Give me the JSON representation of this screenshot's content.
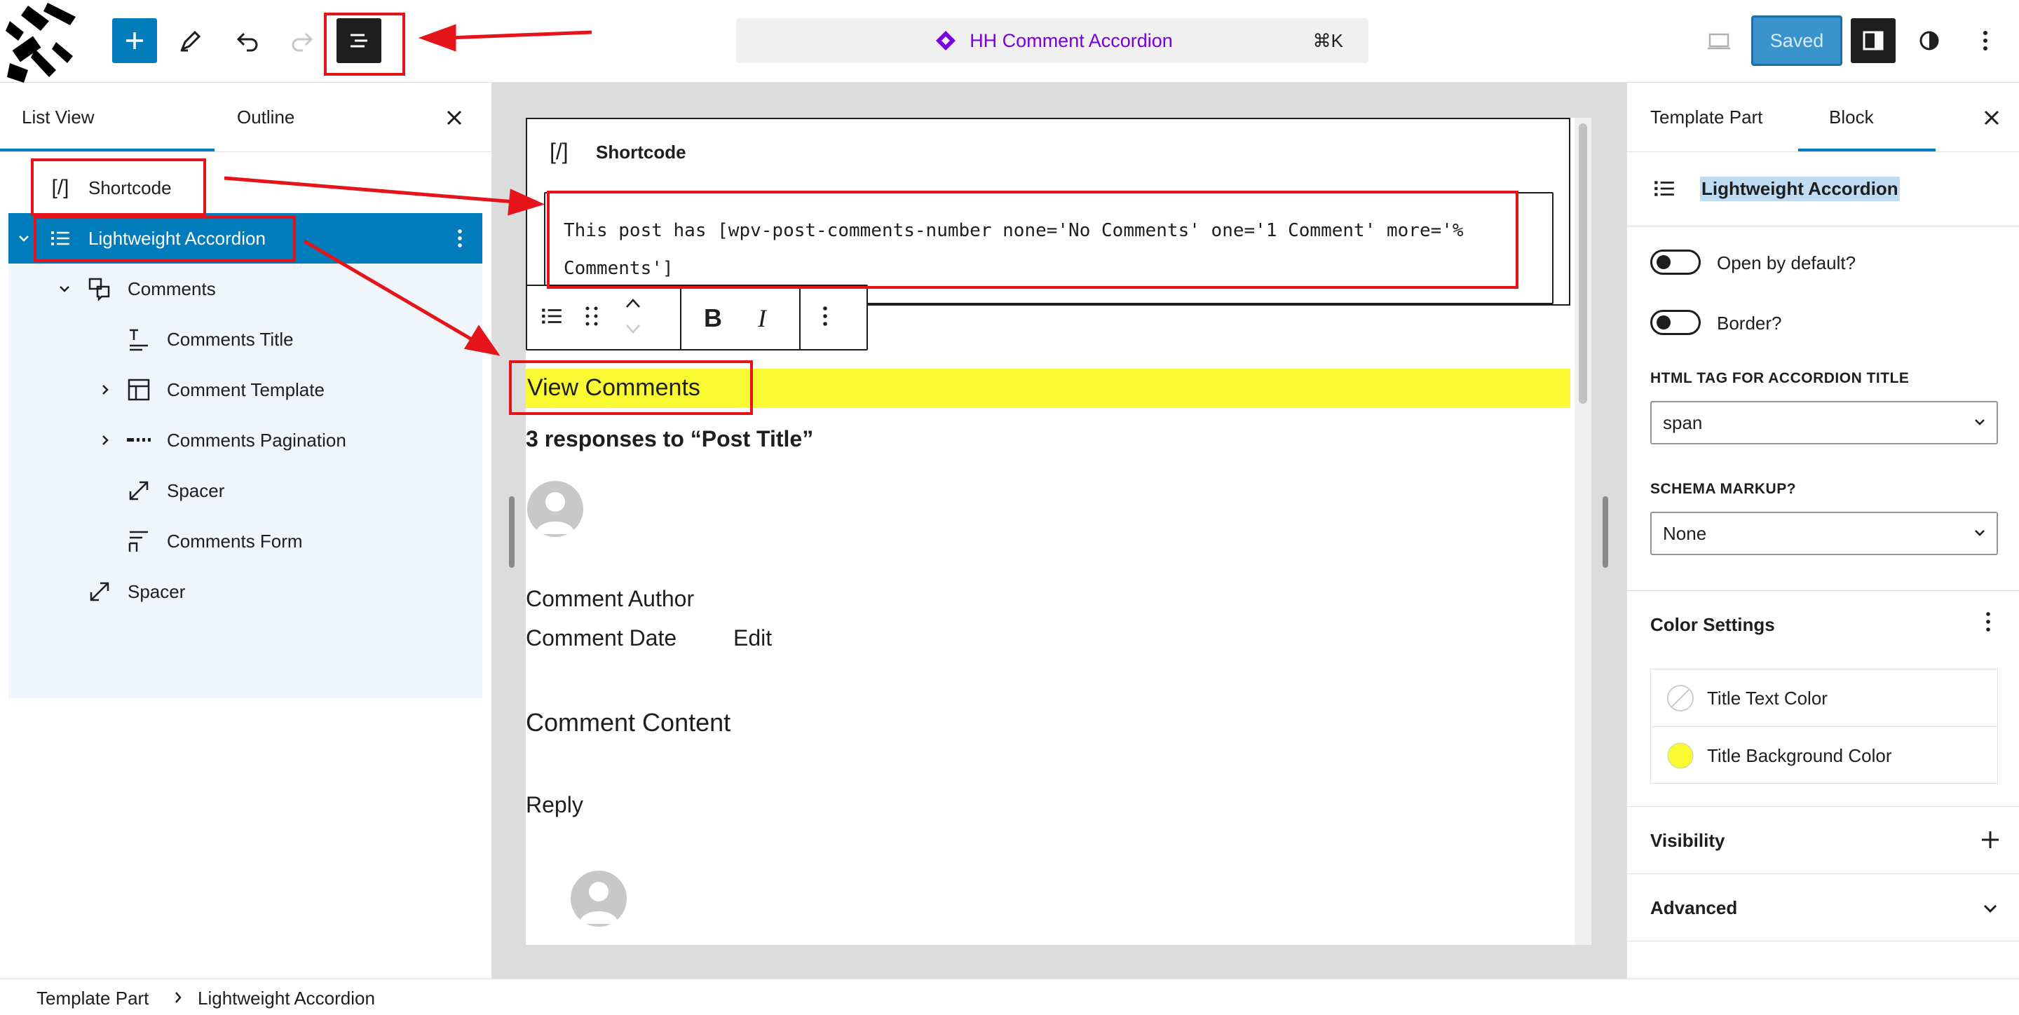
{
  "header": {
    "add_icon": "plus-icon",
    "tools_icon": "pencil-icon",
    "undo_icon": "undo-icon",
    "redo_icon": "redo-icon",
    "list_view_icon": "list-view-icon",
    "command_title": "HH Comment Accordion",
    "command_shortcut": "⌘K",
    "saved_label": "Saved",
    "accent": "#007cba"
  },
  "left_panel": {
    "tabs": [
      "List View",
      "Outline"
    ],
    "tree": [
      {
        "label": "Shortcode",
        "icon": "shortcode-icon"
      },
      {
        "label": "Lightweight Accordion",
        "icon": "list-icon",
        "selected": true
      },
      {
        "label": "Comments",
        "icon": "comments-icon"
      },
      {
        "label": "Comments Title",
        "icon": "title-icon"
      },
      {
        "label": "Comment Template",
        "icon": "layout-icon"
      },
      {
        "label": "Comments Pagination",
        "icon": "pagination-icon"
      },
      {
        "label": "Spacer",
        "icon": "spacer-icon"
      },
      {
        "label": "Comments Form",
        "icon": "form-icon"
      },
      {
        "label": "Spacer",
        "icon": "spacer-icon"
      }
    ]
  },
  "canvas": {
    "shortcode_label": "Shortcode",
    "shortcode_icon": "[/]",
    "shortcode_text": "This post has [wpv-post-comments-number none='No Comments' one='1 Comment' more='% Comments']",
    "toolbar_bold": "B",
    "toolbar_italic": "I",
    "accordion_title": "View Comments",
    "accordion_bg": "#fafa33",
    "responses": "3 responses to “Post Title”",
    "comment_author": "Comment Author",
    "comment_date": "Comment Date",
    "edit": "Edit",
    "comment_content": "Comment Content",
    "reply": "Reply"
  },
  "right_panel": {
    "tabs": [
      "Template Part",
      "Block"
    ],
    "block_name": "Lightweight Accordion",
    "open_by_default": "Open by default?",
    "border": "Border?",
    "html_tag_label": "HTML TAG FOR ACCORDION TITLE",
    "html_tag_value": "span",
    "schema_label": "SCHEMA MARKUP?",
    "schema_value": "None",
    "color_settings": "Color Settings",
    "title_text_color": "Title Text Color",
    "title_bg_color": "Title Background Color",
    "visibility": "Visibility",
    "advanced": "Advanced"
  },
  "breadcrumb": [
    "Template Part",
    "Lightweight Accordion"
  ]
}
